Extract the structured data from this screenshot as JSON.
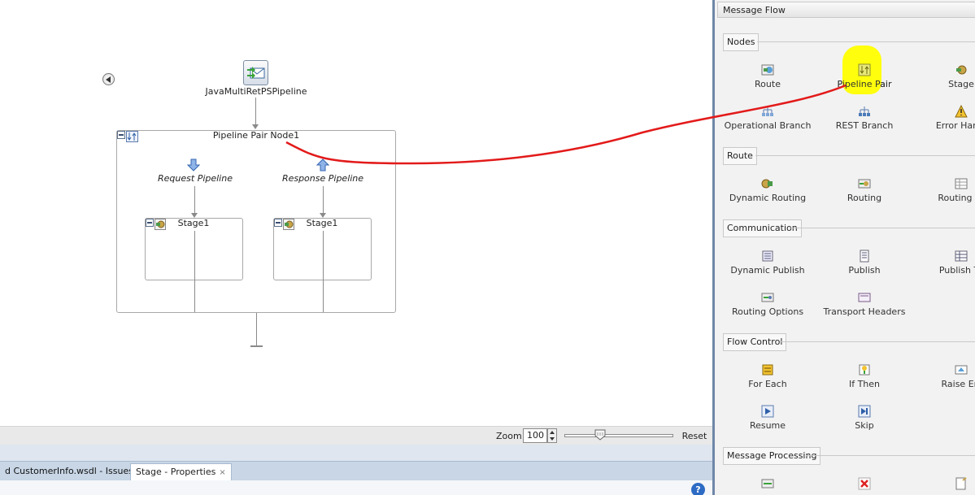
{
  "diagram": {
    "proxy_label": "JavaMultiRetPSPipeline",
    "pipeline_pair_title": "Pipeline Pair Node1",
    "request_label": "Request Pipeline",
    "response_label": "Response Pipeline",
    "stage_left": "Stage1",
    "stage_right": "Stage1"
  },
  "zoombar": {
    "zoom_label": "Zoom:",
    "zoom_value": "100",
    "zoom_level_fraction": 0.33,
    "reset_label": "Reset"
  },
  "bottom": {
    "tab_issues": "d CustomerInfo.wsdl - Issues",
    "tab_properties": "Stage - Properties",
    "tab_close": "×",
    "help": "?"
  },
  "palette": {
    "header": "Message Flow",
    "sections": {
      "nodes": "Nodes",
      "route": "Route",
      "communication": "Communication",
      "flow_control": "Flow Control",
      "message_processing": "Message Processing"
    },
    "items": {
      "route": "Route",
      "pipeline_pair": "Pipeline Pair",
      "stage": "Stage",
      "operational_branch": "Operational Branch",
      "rest_branch": "REST Branch",
      "error_handler": "Error Handl",
      "dynamic_routing": "Dynamic Routing",
      "routing": "Routing",
      "routing_table": "Routing Ta",
      "dynamic_publish": "Dynamic Publish",
      "publish": "Publish",
      "publish_table": "Publish Ta",
      "routing_options": "Routing Options",
      "transport_headers": "Transport Headers",
      "for_each": "For Each",
      "if_then": "If Then",
      "raise_error": "Raise Err",
      "resume": "Resume",
      "skip": "Skip"
    }
  },
  "colors": {
    "annotation_line": "#e31a1a",
    "highlight": "#ffff00",
    "divider": "#6f87a8"
  }
}
